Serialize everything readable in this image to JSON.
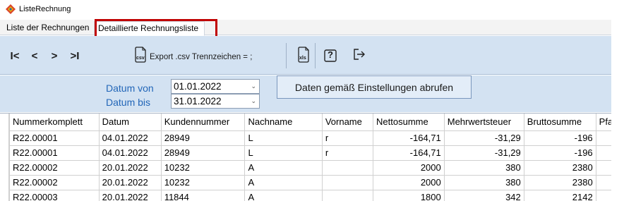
{
  "window": {
    "title": "ListeRechnung"
  },
  "tabs": [
    {
      "label": "Liste der Rechnungen"
    },
    {
      "label": "Detaillierte Rechnungsliste"
    }
  ],
  "toolbar": {
    "first": "I<",
    "prev": "<",
    "next": ">",
    "last": ">I",
    "csv_icon_text": "csv",
    "export_label": "Export .csv Trennzeichen = ;",
    "xls_icon_text": "xls",
    "help": "?"
  },
  "filter": {
    "von_label": "Datum von",
    "bis_label": "Datum bis",
    "von_value": "01.01.2022",
    "bis_value": "31.01.2022",
    "fetch_label": "Daten gemäß Einstellungen abrufen"
  },
  "grid": {
    "columns": [
      "Nummerkomplett",
      "Datum",
      "Kundennummer",
      "Nachname",
      "Vorname",
      "Nettosumme",
      "Mehrwertsteuer",
      "Bruttosumme",
      "Pfa"
    ],
    "rows": [
      [
        "R22.00001",
        "04.01.2022",
        "28949",
        "L",
        "r",
        "-164,71",
        "-31,29",
        "-196",
        ""
      ],
      [
        "R22.00001",
        "04.01.2022",
        "28949",
        "L",
        "r",
        "-164,71",
        "-31,29",
        "-196",
        ""
      ],
      [
        "R22.00002",
        "20.01.2022",
        "10232",
        "A",
        "",
        "2000",
        "380",
        "2380",
        ""
      ],
      [
        "R22.00002",
        "20.01.2022",
        "10232",
        "A",
        "",
        "2000",
        "380",
        "2380",
        ""
      ],
      [
        "R22.00003",
        "20.01.2022",
        "11844",
        "A",
        "",
        "1800",
        "342",
        "2142",
        ""
      ]
    ]
  },
  "colors": {
    "accent_label": "#2266b8",
    "highlight": "#c00000",
    "toolbar_bg": "#d3e2f2"
  }
}
